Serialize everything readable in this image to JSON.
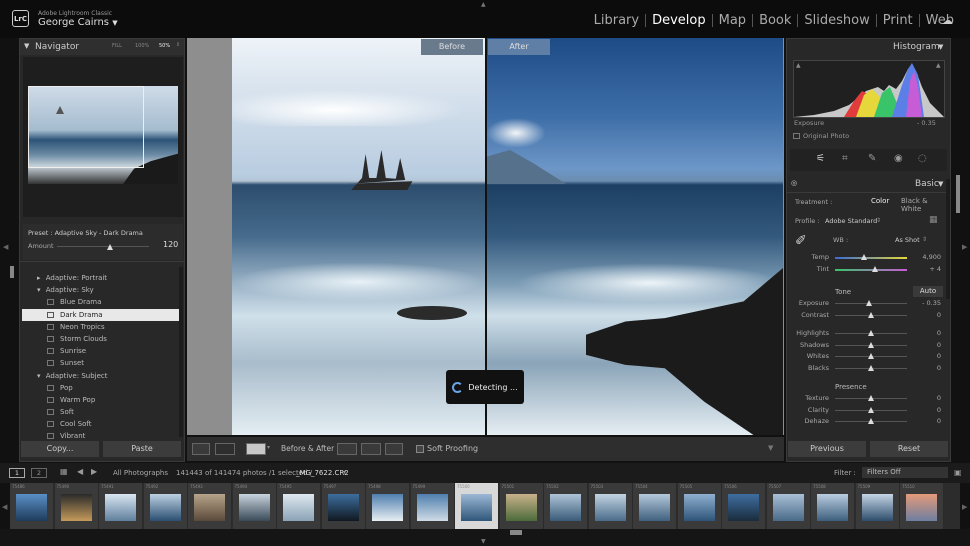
{
  "app": {
    "name": "Adobe Lightroom Classic",
    "user": "George Cairns",
    "logo": "LrC",
    "modules": [
      "Library",
      "Develop",
      "Map",
      "Book",
      "Slideshow",
      "Print",
      "Web"
    ],
    "active_module": "Develop"
  },
  "navigator": {
    "title": "Navigator",
    "zoom_options": [
      "FILL",
      "100%",
      "50%"
    ],
    "active_zoom": "50%"
  },
  "preset_amount": {
    "preset_label": "Preset : Adaptive Sky - Dark Drama",
    "amount_label": "Amount",
    "amount_value": "120"
  },
  "presets": [
    {
      "label": "Adaptive: Portrait",
      "type": "folder",
      "expanded": false
    },
    {
      "label": "Adaptive: Sky",
      "type": "folder",
      "expanded": true
    },
    {
      "label": "Blue Drama",
      "type": "preset"
    },
    {
      "label": "Dark Drama",
      "type": "preset",
      "selected": true
    },
    {
      "label": "Neon Tropics",
      "type": "preset"
    },
    {
      "label": "Storm Clouds",
      "type": "preset"
    },
    {
      "label": "Sunrise",
      "type": "preset"
    },
    {
      "label": "Sunset",
      "type": "preset"
    },
    {
      "label": "Adaptive: Subject",
      "type": "folder",
      "expanded": true
    },
    {
      "label": "Pop",
      "type": "preset"
    },
    {
      "label": "Warm Pop",
      "type": "preset"
    },
    {
      "label": "Soft",
      "type": "preset"
    },
    {
      "label": "Cool Soft",
      "type": "preset"
    },
    {
      "label": "Vibrant",
      "type": "preset"
    }
  ],
  "left_buttons": {
    "copy": "Copy...",
    "paste": "Paste"
  },
  "view": {
    "before_label": "Before",
    "after_label": "After",
    "detecting_label": "Detecting ..."
  },
  "toolbar": {
    "before_after_label": "Before & After :",
    "soft_proofing_label": "Soft Proofing"
  },
  "histogram": {
    "title": "Histogram",
    "exposure_label": "Exposure",
    "exposure_value": "- 0.35",
    "original_photo_label": "Original Photo"
  },
  "basic": {
    "title": "Basic",
    "treatment_label": "Treatment :",
    "treatment_options": [
      "Color",
      "Black & White"
    ],
    "profile_label": "Profile :",
    "profile_value": "Adobe Standard",
    "wb_label": "WB :",
    "wb_value": "As Shot",
    "temp": {
      "label": "Temp",
      "value": "4,900",
      "fraction": 0.4
    },
    "tint": {
      "label": "Tint",
      "value": "+ 4",
      "fraction": 0.55
    },
    "tone_label": "Tone",
    "auto_label": "Auto",
    "tone_sliders": [
      {
        "label": "Exposure",
        "value": "- 0.35",
        "fraction": 0.47
      },
      {
        "label": "Contrast",
        "value": "0",
        "fraction": 0.5
      }
    ],
    "tone_sliders2": [
      {
        "label": "Highlights",
        "value": "0",
        "fraction": 0.5
      },
      {
        "label": "Shadows",
        "value": "0",
        "fraction": 0.5
      },
      {
        "label": "Whites",
        "value": "0",
        "fraction": 0.5
      },
      {
        "label": "Blacks",
        "value": "0",
        "fraction": 0.5
      }
    ],
    "presence_label": "Presence",
    "presence_sliders": [
      {
        "label": "Texture",
        "value": "0",
        "fraction": 0.5
      },
      {
        "label": "Clarity",
        "value": "0",
        "fraction": 0.5
      },
      {
        "label": "Dehaze",
        "value": "0",
        "fraction": 0.5
      }
    ]
  },
  "right_buttons": {
    "previous": "Previous",
    "reset": "Reset"
  },
  "filmstrip_bar": {
    "page1": "1",
    "page2": "2",
    "source": "All Photographs",
    "count": "141443 of 141474 photos /1 selected /",
    "filename": "_MG_7622.CR2",
    "filter_label": "Filter :",
    "filter_value": "Filters Off"
  },
  "filmstrip": {
    "thumbs": [
      {
        "num": "75486",
        "colors": [
          "#5a8fc6",
          "#1e3c5c"
        ]
      },
      {
        "num": "75490",
        "colors": [
          "#2a2a2a",
          "#c49a5a"
        ]
      },
      {
        "num": "75491",
        "colors": [
          "#d9e6f2",
          "#5f7f9c"
        ]
      },
      {
        "num": "75492",
        "colors": [
          "#bcd0e2",
          "#2b4f72"
        ]
      },
      {
        "num": "75493",
        "colors": [
          "#b8a48a",
          "#5a4a3a"
        ]
      },
      {
        "num": "75494",
        "colors": [
          "#c8d4de",
          "#3a4a58"
        ]
      },
      {
        "num": "75495",
        "colors": [
          "#dfe8ef",
          "#8aa3b6"
        ]
      },
      {
        "num": "75497",
        "colors": [
          "#3e6e9e",
          "#101820"
        ]
      },
      {
        "num": "75498",
        "colors": [
          "#4f7fae",
          "#e8eef3"
        ]
      },
      {
        "num": "75499",
        "colors": [
          "#4f7fae",
          "#cfdce6"
        ]
      },
      {
        "num": "75500",
        "colors": [
          "#9cb8d6",
          "#2f5679"
        ]
      },
      {
        "num": "75501",
        "colors": [
          "#c9b18a",
          "#4c6b3a"
        ]
      },
      {
        "num": "75502",
        "colors": [
          "#aec4d8",
          "#3a5b78"
        ]
      },
      {
        "num": "75503",
        "colors": [
          "#c2d3e2",
          "#4a6c8a"
        ]
      },
      {
        "num": "75504",
        "colors": [
          "#b5c9db",
          "#3f607e"
        ]
      },
      {
        "num": "75505",
        "colors": [
          "#8fb0d0",
          "#2e5479"
        ]
      },
      {
        "num": "75506",
        "colors": [
          "#3e6ea0",
          "#1b2c3d"
        ]
      },
      {
        "num": "75507",
        "colors": [
          "#a9c0d6",
          "#496a88"
        ]
      },
      {
        "num": "75508",
        "colors": [
          "#b9cde0",
          "#3d5f7d"
        ]
      },
      {
        "num": "75509",
        "colors": [
          "#c4d5e5",
          "#2e4e6c"
        ]
      },
      {
        "num": "75510",
        "colors": [
          "#e49a7a",
          "#6d7fa0"
        ]
      }
    ]
  }
}
